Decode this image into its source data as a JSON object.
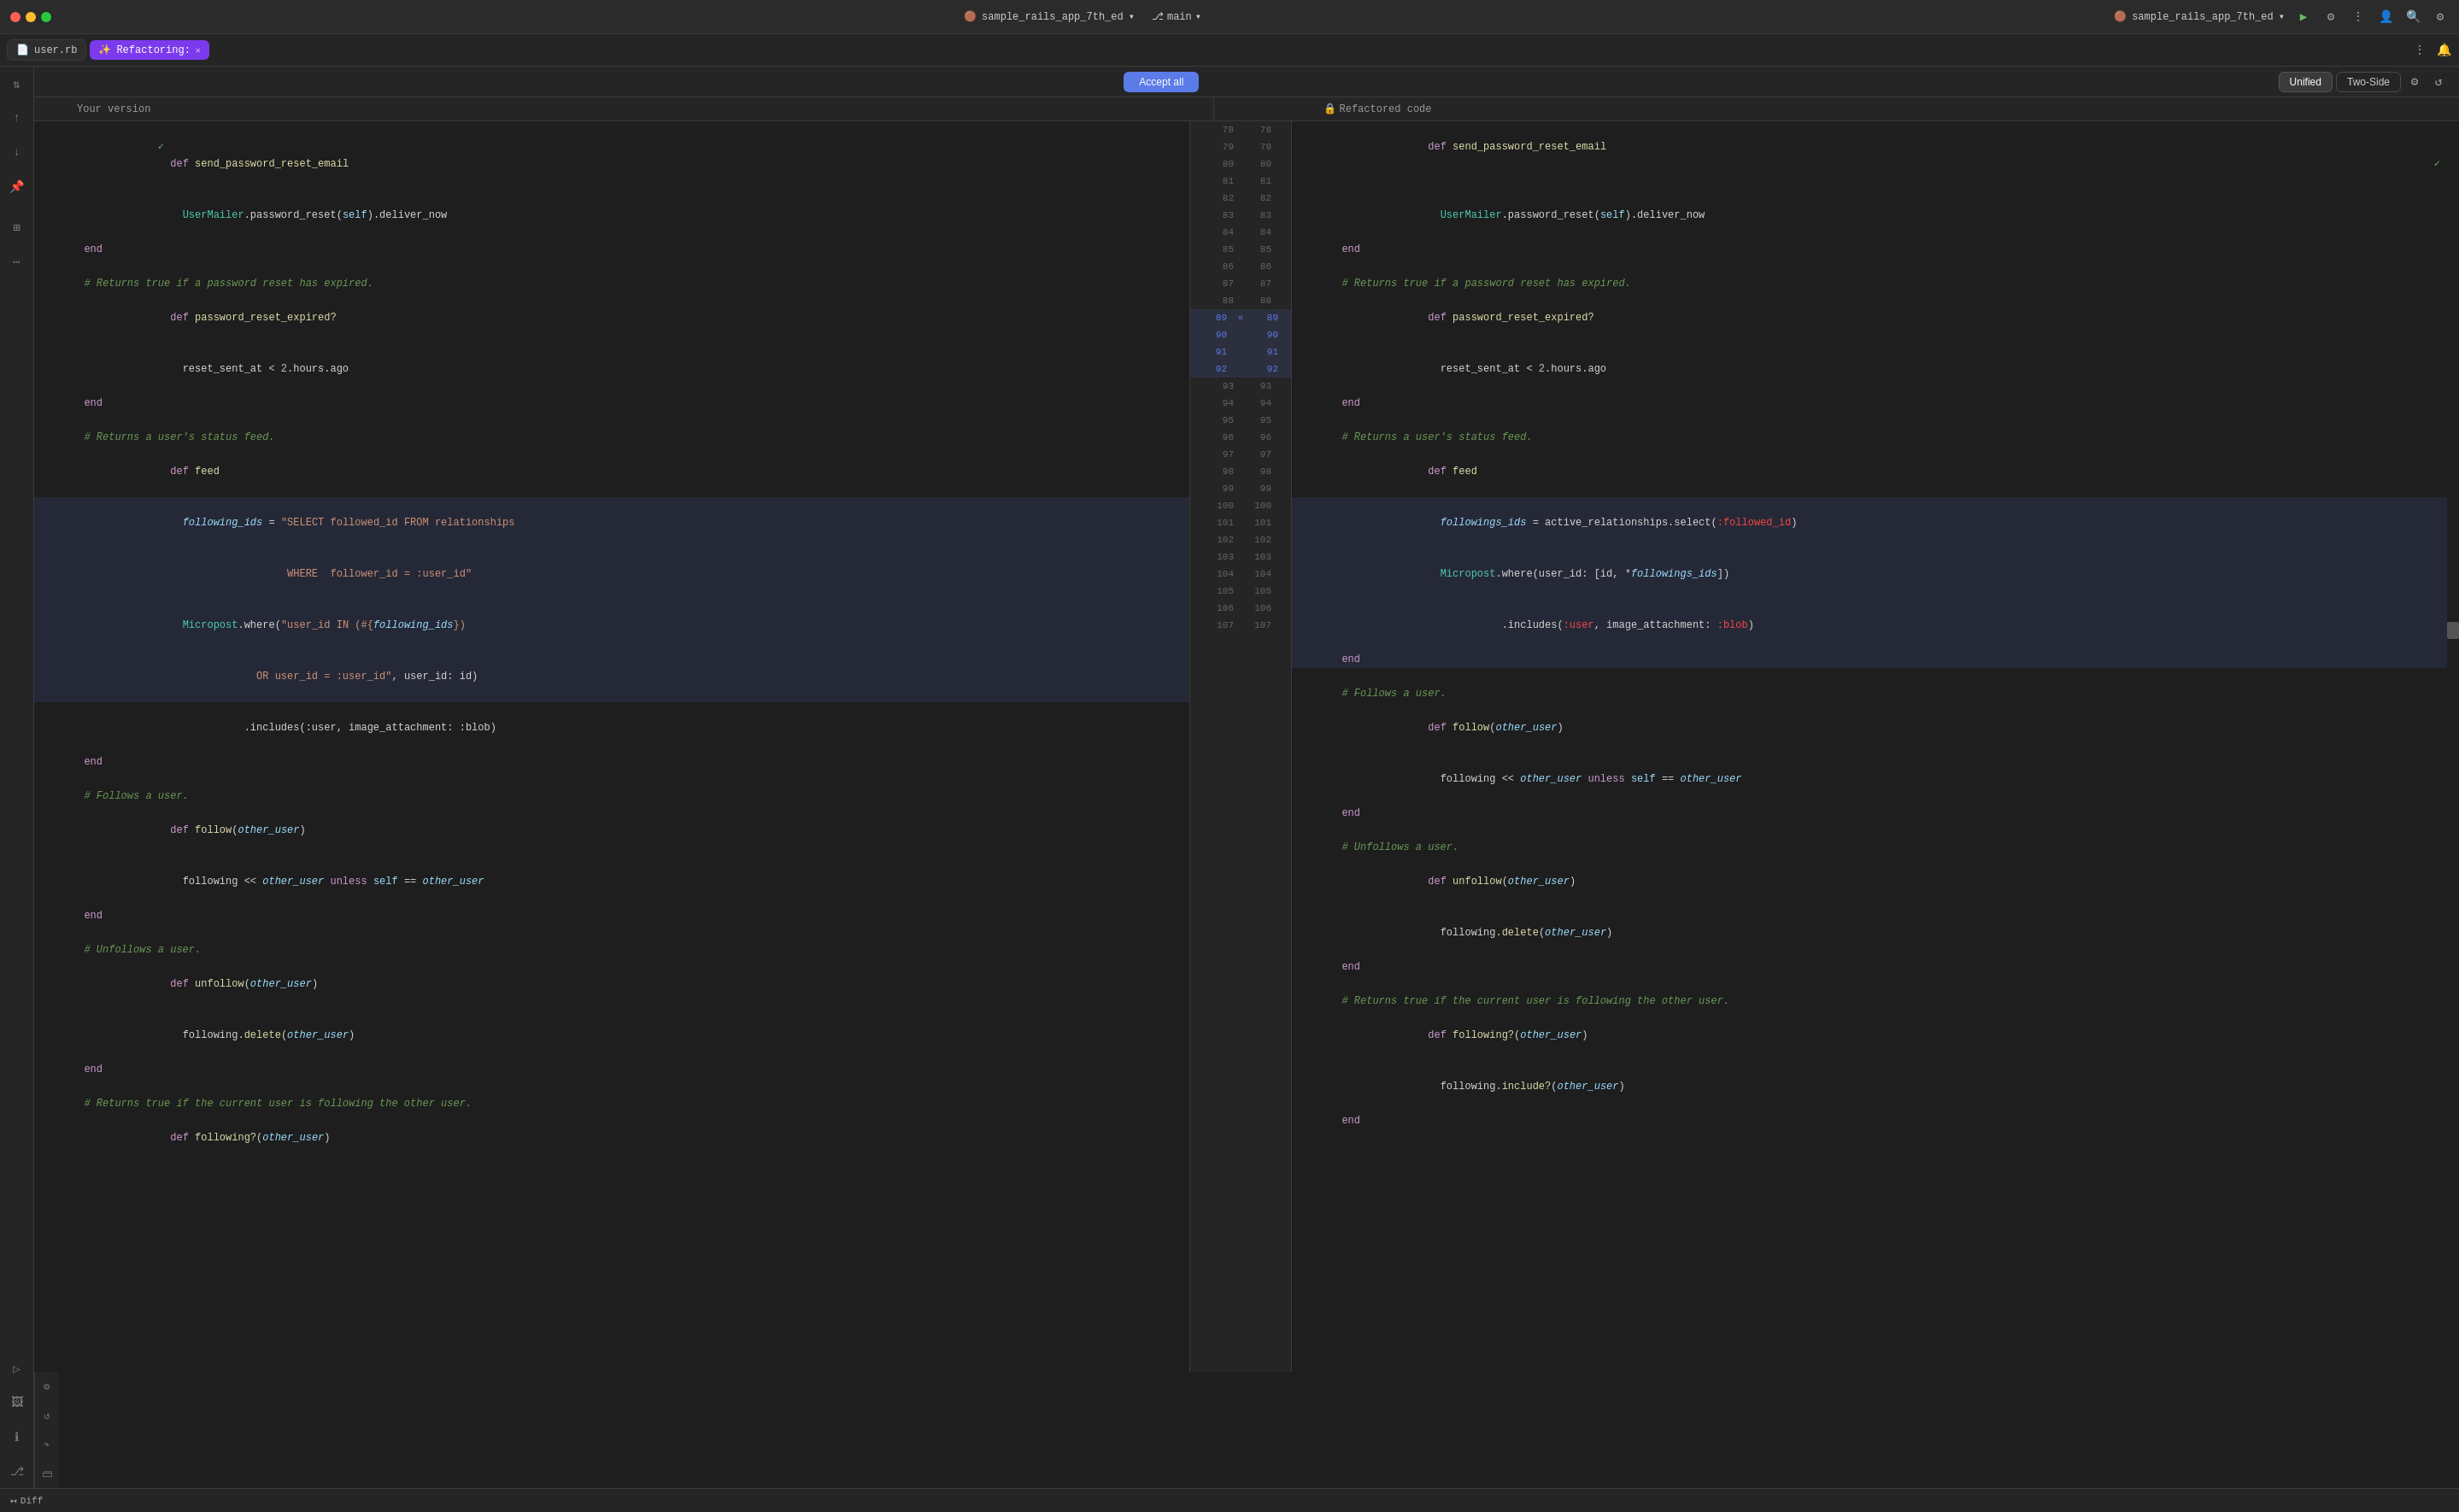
{
  "titleBar": {
    "appName": "sample_rails_app_7th_ed",
    "branch": "main",
    "appName2": "sample_rails_app_7th_ed"
  },
  "tabs": [
    {
      "id": "file",
      "label": "user.rb",
      "type": "file"
    },
    {
      "id": "ai",
      "label": "Refactoring:",
      "type": "ai",
      "active": true
    }
  ],
  "toolbar": {
    "acceptAllLabel": "Accept all",
    "unifiedLabel": "Unified",
    "twoSideLabel": "Two-Side"
  },
  "diffHeaders": {
    "yourVersion": "Your version",
    "refactoredCode": "Refactored code"
  },
  "lines": [
    {
      "ln": 78,
      "left": "  def send_password_reset_email",
      "right": "  def send_password_reset_email",
      "type": "same"
    },
    {
      "ln": 79,
      "left": "    UserMailer.password_reset(self).deliver_now",
      "right": "    UserMailer.password_reset(self).deliver_now",
      "type": "same"
    },
    {
      "ln": 80,
      "left": "  end",
      "right": "  end",
      "type": "same"
    },
    {
      "ln": 81,
      "left": "",
      "right": "",
      "type": "same"
    },
    {
      "ln": 82,
      "left": "  # Returns true if a password reset has expired.",
      "right": "  # Returns true if a password reset has expired.",
      "type": "same"
    },
    {
      "ln": 83,
      "left": "  def password_reset_expired?",
      "right": "  def password_reset_expired?",
      "type": "same"
    },
    {
      "ln": 84,
      "left": "    reset_sent_at < 2.hours.ago",
      "right": "    reset_sent_at < 2.hours.ago",
      "type": "same"
    },
    {
      "ln": 85,
      "left": "  end",
      "right": "  end",
      "type": "same"
    },
    {
      "ln": 86,
      "left": "",
      "right": "",
      "type": "same"
    },
    {
      "ln": 87,
      "left": "  # Returns a user's status feed.",
      "right": "  # Returns a user's status feed.",
      "type": "same"
    },
    {
      "ln": 88,
      "left": "  def feed",
      "right": "  def feed",
      "type": "same"
    },
    {
      "ln": 89,
      "left": "    following_ids = \"SELECT followed_id FROM relationships",
      "right": "    followings_ids = active_relationships.select(:followed_id)",
      "type": "changed"
    },
    {
      "ln": 90,
      "left": "                     WHERE  follower_id = :user_id\"",
      "right": "    Micropost.where(user_id: [id, *followings_ids])",
      "type": "changed"
    },
    {
      "ln": 91,
      "left": "    Micropost.where(\"user_id IN (#{following_ids})",
      "right": "              .includes(:user, image_attachment: :blob)",
      "type": "changed"
    },
    {
      "ln": 92,
      "left": "                OR user_id = :user_id\", user_id: id)",
      "right": "  end",
      "type": "changed"
    },
    {
      "ln": 93,
      "left": "              .includes(:user, image_attachment: :blob)",
      "right": "",
      "type": "removed"
    },
    {
      "ln": 94,
      "left": "  end",
      "right": "  # Follows a user.",
      "type": "mixed"
    },
    {
      "ln": 95,
      "left": "",
      "right": "  def follow(other_user)",
      "type": "mixed"
    },
    {
      "ln": 96,
      "left": "  # Follows a user.",
      "right": "    following << other_user unless self == other_user",
      "type": "mixed"
    },
    {
      "ln": 97,
      "left": "  def follow(other_user)",
      "right": "  end",
      "type": "same"
    },
    {
      "ln": 98,
      "left": "    following << other_user unless self == other_user",
      "right": "",
      "type": "same"
    },
    {
      "ln": 99,
      "left": "  end",
      "right": "  # Unfollows a user.",
      "type": "mixed"
    },
    {
      "ln": 100,
      "left": "",
      "right": "  def unfollow(other_user)",
      "type": "mixed"
    },
    {
      "ln": 101,
      "left": "  # Unfollows a user.",
      "right": "    following.delete(other_user)",
      "type": "same"
    },
    {
      "ln": 102,
      "left": "  def unfollow(other_user)",
      "right": "  end",
      "type": "same"
    },
    {
      "ln": 103,
      "left": "    following.delete(other_user)",
      "right": "",
      "type": "same"
    },
    {
      "ln": 104,
      "left": "  end",
      "right": "  # Returns true if the current user is following the other user.",
      "type": "mixed"
    },
    {
      "ln": 105,
      "left": "",
      "right": "  def following?(other_user)",
      "type": "mixed"
    },
    {
      "ln": 106,
      "left": "  # Returns true if the current user is following the other user.",
      "right": "    following.include?(other_user)",
      "type": "same"
    },
    {
      "ln": 107,
      "left": "  def following?(other_user)",
      "right": "  end",
      "type": "same"
    }
  ],
  "bottomBar": {
    "diffLabel": "Diff"
  }
}
